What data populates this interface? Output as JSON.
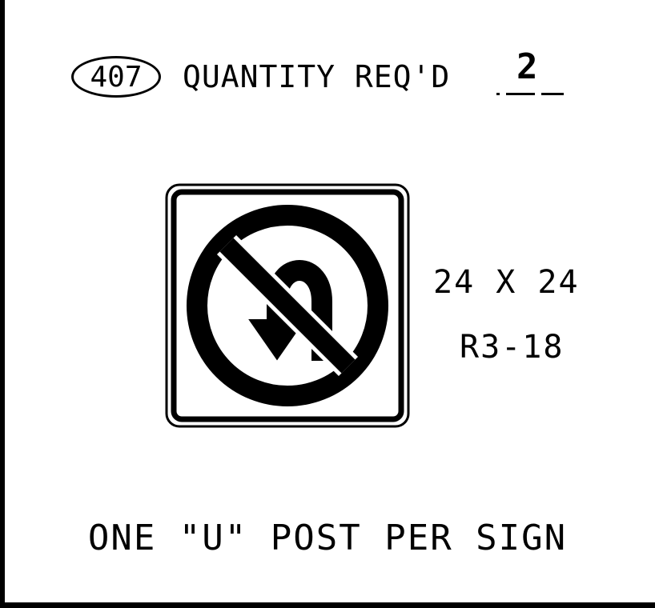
{
  "header": {
    "item_number": "407",
    "quantity_label": "QUANTITY REQ'D",
    "quantity_value": "2"
  },
  "sign": {
    "icon": "no-u-turn-icon",
    "dimensions": "24 X 24",
    "code": "R3-18"
  },
  "note": "ONE \"U\" POST PER SIGN",
  "colors": {
    "ink": "#000000",
    "background": "#ffffff"
  }
}
